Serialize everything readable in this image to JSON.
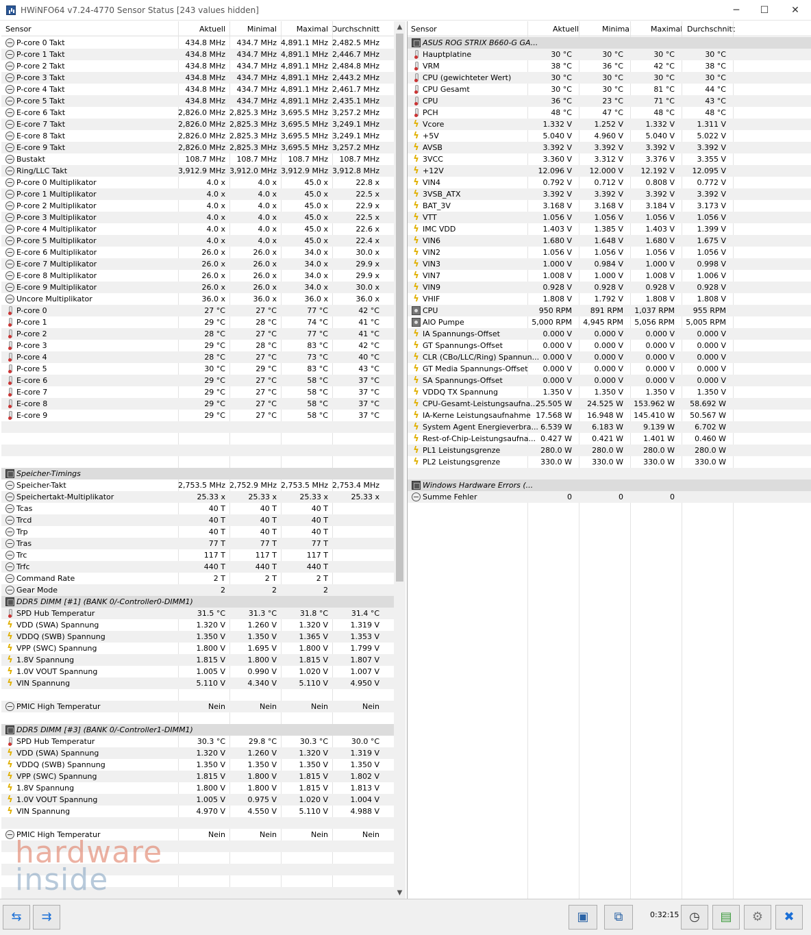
{
  "window": {
    "title": "HWiNFO64 v7.24-4770 Sensor Status [243 values hidden]",
    "minimize": "─",
    "maximize": "☐",
    "close": "✕"
  },
  "columns": {
    "sensor": "Sensor",
    "current": "Aktuell",
    "min": "Minimal",
    "max": "Maximal",
    "avg": "Durchschnitt"
  },
  "left_rows": [
    {
      "i": "clk",
      "n": "P-core 0 Takt",
      "a": "434.8 MHz",
      "mi": "434.7 MHz",
      "ma": "4,891.1 MHz",
      "av": "2,482.5 MHz"
    },
    {
      "i": "clk",
      "n": "P-core 1 Takt",
      "a": "434.8 MHz",
      "mi": "434.7 MHz",
      "ma": "4,891.1 MHz",
      "av": "2,446.7 MHz"
    },
    {
      "i": "clk",
      "n": "P-core 2 Takt",
      "a": "434.8 MHz",
      "mi": "434.7 MHz",
      "ma": "4,891.1 MHz",
      "av": "2,484.8 MHz"
    },
    {
      "i": "clk",
      "n": "P-core 3 Takt",
      "a": "434.8 MHz",
      "mi": "434.7 MHz",
      "ma": "4,891.1 MHz",
      "av": "2,443.2 MHz"
    },
    {
      "i": "clk",
      "n": "P-core 4 Takt",
      "a": "434.8 MHz",
      "mi": "434.7 MHz",
      "ma": "4,891.1 MHz",
      "av": "2,461.7 MHz"
    },
    {
      "i": "clk",
      "n": "P-core 5 Takt",
      "a": "434.8 MHz",
      "mi": "434.7 MHz",
      "ma": "4,891.1 MHz",
      "av": "2,435.1 MHz"
    },
    {
      "i": "clk",
      "n": "E-core 6 Takt",
      "a": "2,826.0 MHz",
      "mi": "2,825.3 MHz",
      "ma": "3,695.5 MHz",
      "av": "3,257.2 MHz"
    },
    {
      "i": "clk",
      "n": "E-core 7 Takt",
      "a": "2,826.0 MHz",
      "mi": "2,825.3 MHz",
      "ma": "3,695.5 MHz",
      "av": "3,249.1 MHz"
    },
    {
      "i": "clk",
      "n": "E-core 8 Takt",
      "a": "2,826.0 MHz",
      "mi": "2,825.3 MHz",
      "ma": "3,695.5 MHz",
      "av": "3,249.1 MHz"
    },
    {
      "i": "clk",
      "n": "E-core 9 Takt",
      "a": "2,826.0 MHz",
      "mi": "2,825.3 MHz",
      "ma": "3,695.5 MHz",
      "av": "3,257.2 MHz"
    },
    {
      "i": "clk",
      "n": "Bustakt",
      "a": "108.7 MHz",
      "mi": "108.7 MHz",
      "ma": "108.7 MHz",
      "av": "108.7 MHz"
    },
    {
      "i": "clk",
      "n": "Ring/LLC Takt",
      "a": "3,912.9 MHz",
      "mi": "3,912.0 MHz",
      "ma": "3,912.9 MHz",
      "av": "3,912.8 MHz"
    },
    {
      "i": "clk",
      "n": "P-core 0 Multiplikator",
      "a": "4.0 x",
      "mi": "4.0 x",
      "ma": "45.0 x",
      "av": "22.8 x"
    },
    {
      "i": "clk",
      "n": "P-core 1 Multiplikator",
      "a": "4.0 x",
      "mi": "4.0 x",
      "ma": "45.0 x",
      "av": "22.5 x"
    },
    {
      "i": "clk",
      "n": "P-core 2 Multiplikator",
      "a": "4.0 x",
      "mi": "4.0 x",
      "ma": "45.0 x",
      "av": "22.9 x"
    },
    {
      "i": "clk",
      "n": "P-core 3 Multiplikator",
      "a": "4.0 x",
      "mi": "4.0 x",
      "ma": "45.0 x",
      "av": "22.5 x"
    },
    {
      "i": "clk",
      "n": "P-core 4 Multiplikator",
      "a": "4.0 x",
      "mi": "4.0 x",
      "ma": "45.0 x",
      "av": "22.6 x"
    },
    {
      "i": "clk",
      "n": "P-core 5 Multiplikator",
      "a": "4.0 x",
      "mi": "4.0 x",
      "ma": "45.0 x",
      "av": "22.4 x"
    },
    {
      "i": "clk",
      "n": "E-core 6 Multiplikator",
      "a": "26.0 x",
      "mi": "26.0 x",
      "ma": "34.0 x",
      "av": "30.0 x"
    },
    {
      "i": "clk",
      "n": "E-core 7 Multiplikator",
      "a": "26.0 x",
      "mi": "26.0 x",
      "ma": "34.0 x",
      "av": "29.9 x"
    },
    {
      "i": "clk",
      "n": "E-core 8 Multiplikator",
      "a": "26.0 x",
      "mi": "26.0 x",
      "ma": "34.0 x",
      "av": "29.9 x"
    },
    {
      "i": "clk",
      "n": "E-core 9 Multiplikator",
      "a": "26.0 x",
      "mi": "26.0 x",
      "ma": "34.0 x",
      "av": "30.0 x"
    },
    {
      "i": "clk",
      "n": "Uncore Multiplikator",
      "a": "36.0 x",
      "mi": "36.0 x",
      "ma": "36.0 x",
      "av": "36.0 x"
    },
    {
      "i": "thm",
      "n": "P-core 0",
      "a": "27 °C",
      "mi": "27 °C",
      "ma": "77 °C",
      "av": "42 °C"
    },
    {
      "i": "thm",
      "n": "P-core 1",
      "a": "29 °C",
      "mi": "28 °C",
      "ma": "74 °C",
      "av": "41 °C"
    },
    {
      "i": "thm",
      "n": "P-core 2",
      "a": "28 °C",
      "mi": "27 °C",
      "ma": "77 °C",
      "av": "41 °C"
    },
    {
      "i": "thm",
      "n": "P-core 3",
      "a": "29 °C",
      "mi": "28 °C",
      "ma": "83 °C",
      "av": "42 °C"
    },
    {
      "i": "thm",
      "n": "P-core 4",
      "a": "28 °C",
      "mi": "27 °C",
      "ma": "73 °C",
      "av": "40 °C"
    },
    {
      "i": "thm",
      "n": "P-core 5",
      "a": "30 °C",
      "mi": "29 °C",
      "ma": "83 °C",
      "av": "43 °C"
    },
    {
      "i": "thm",
      "n": "E-core 6",
      "a": "29 °C",
      "mi": "27 °C",
      "ma": "58 °C",
      "av": "37 °C"
    },
    {
      "i": "thm",
      "n": "E-core 7",
      "a": "29 °C",
      "mi": "27 °C",
      "ma": "58 °C",
      "av": "37 °C"
    },
    {
      "i": "thm",
      "n": "E-core 8",
      "a": "29 °C",
      "mi": "27 °C",
      "ma": "58 °C",
      "av": "37 °C"
    },
    {
      "i": "thm",
      "n": "E-core 9",
      "a": "29 °C",
      "mi": "27 °C",
      "ma": "58 °C",
      "av": "37 °C"
    },
    {
      "i": "",
      "n": "",
      "a": "",
      "mi": "",
      "ma": "",
      "av": ""
    },
    {
      "i": "",
      "n": "",
      "a": "",
      "mi": "",
      "ma": "",
      "av": ""
    },
    {
      "i": "",
      "n": "",
      "a": "",
      "mi": "",
      "ma": "",
      "av": ""
    },
    {
      "i": "",
      "n": "",
      "a": "",
      "mi": "",
      "ma": "",
      "av": ""
    },
    {
      "i": "chip",
      "g": true,
      "n": "Speicher-Timings",
      "a": "",
      "mi": "",
      "ma": "",
      "av": ""
    },
    {
      "i": "clk",
      "n": "Speicher-Takt",
      "a": "2,753.5 MHz",
      "mi": "2,752.9 MHz",
      "ma": "2,753.5 MHz",
      "av": "2,753.4 MHz"
    },
    {
      "i": "clk",
      "n": "Speichertakt-Multiplikator",
      "a": "25.33 x",
      "mi": "25.33 x",
      "ma": "25.33 x",
      "av": "25.33 x"
    },
    {
      "i": "clk",
      "n": "Tcas",
      "a": "40 T",
      "mi": "40 T",
      "ma": "40 T",
      "av": ""
    },
    {
      "i": "clk",
      "n": "Trcd",
      "a": "40 T",
      "mi": "40 T",
      "ma": "40 T",
      "av": ""
    },
    {
      "i": "clk",
      "n": "Trp",
      "a": "40 T",
      "mi": "40 T",
      "ma": "40 T",
      "av": ""
    },
    {
      "i": "clk",
      "n": "Tras",
      "a": "77 T",
      "mi": "77 T",
      "ma": "77 T",
      "av": ""
    },
    {
      "i": "clk",
      "n": "Trc",
      "a": "117 T",
      "mi": "117 T",
      "ma": "117 T",
      "av": ""
    },
    {
      "i": "clk",
      "n": "Trfc",
      "a": "440 T",
      "mi": "440 T",
      "ma": "440 T",
      "av": ""
    },
    {
      "i": "clk",
      "n": "Command Rate",
      "a": "2 T",
      "mi": "2 T",
      "ma": "2 T",
      "av": ""
    },
    {
      "i": "clk",
      "n": "Gear Mode",
      "a": "2",
      "mi": "2",
      "ma": "2",
      "av": ""
    },
    {
      "i": "chip",
      "g": true,
      "n": "DDR5 DIMM [#1] (BANK 0/-Controller0-DIMM1)",
      "a": "",
      "mi": "",
      "ma": "",
      "av": ""
    },
    {
      "i": "thm",
      "n": "SPD Hub Temperatur",
      "a": "31.5 °C",
      "mi": "31.3 °C",
      "ma": "31.8 °C",
      "av": "31.4 °C"
    },
    {
      "i": "volt",
      "n": "VDD (SWA) Spannung",
      "a": "1.320 V",
      "mi": "1.260 V",
      "ma": "1.320 V",
      "av": "1.319 V"
    },
    {
      "i": "volt",
      "n": "VDDQ (SWB) Spannung",
      "a": "1.350 V",
      "mi": "1.350 V",
      "ma": "1.365 V",
      "av": "1.353 V"
    },
    {
      "i": "volt",
      "n": "VPP (SWC) Spannung",
      "a": "1.800 V",
      "mi": "1.695 V",
      "ma": "1.800 V",
      "av": "1.799 V"
    },
    {
      "i": "volt",
      "n": "1.8V Spannung",
      "a": "1.815 V",
      "mi": "1.800 V",
      "ma": "1.815 V",
      "av": "1.807 V"
    },
    {
      "i": "volt",
      "n": "1.0V VOUT Spannung",
      "a": "1.005 V",
      "mi": "0.990 V",
      "ma": "1.020 V",
      "av": "1.007 V"
    },
    {
      "i": "volt",
      "n": "VIN Spannung",
      "a": "5.110 V",
      "mi": "4.340 V",
      "ma": "5.110 V",
      "av": "4.950 V"
    },
    {
      "i": "",
      "n": "",
      "a": "",
      "mi": "",
      "ma": "",
      "av": ""
    },
    {
      "i": "clk",
      "n": "PMIC High Temperatur",
      "a": "Nein",
      "mi": "Nein",
      "ma": "Nein",
      "av": "Nein"
    },
    {
      "i": "",
      "n": "",
      "a": "",
      "mi": "",
      "ma": "",
      "av": ""
    },
    {
      "i": "chip",
      "g": true,
      "n": "DDR5 DIMM [#3] (BANK 0/-Controller1-DIMM1)",
      "a": "",
      "mi": "",
      "ma": "",
      "av": ""
    },
    {
      "i": "thm",
      "n": "SPD Hub Temperatur",
      "a": "30.3 °C",
      "mi": "29.8 °C",
      "ma": "30.3 °C",
      "av": "30.0 °C"
    },
    {
      "i": "volt",
      "n": "VDD (SWA) Spannung",
      "a": "1.320 V",
      "mi": "1.260 V",
      "ma": "1.320 V",
      "av": "1.319 V"
    },
    {
      "i": "volt",
      "n": "VDDQ (SWB) Spannung",
      "a": "1.350 V",
      "mi": "1.350 V",
      "ma": "1.350 V",
      "av": "1.350 V"
    },
    {
      "i": "volt",
      "n": "VPP (SWC) Spannung",
      "a": "1.815 V",
      "mi": "1.800 V",
      "ma": "1.815 V",
      "av": "1.802 V"
    },
    {
      "i": "volt",
      "n": "1.8V Spannung",
      "a": "1.800 V",
      "mi": "1.800 V",
      "ma": "1.815 V",
      "av": "1.813 V"
    },
    {
      "i": "volt",
      "n": "1.0V VOUT Spannung",
      "a": "1.005 V",
      "mi": "0.975 V",
      "ma": "1.020 V",
      "av": "1.004 V"
    },
    {
      "i": "volt",
      "n": "VIN Spannung",
      "a": "4.970 V",
      "mi": "4.550 V",
      "ma": "5.110 V",
      "av": "4.988 V"
    },
    {
      "i": "",
      "n": "",
      "a": "",
      "mi": "",
      "ma": "",
      "av": ""
    },
    {
      "i": "clk",
      "n": "PMIC High Temperatur",
      "a": "Nein",
      "mi": "Nein",
      "ma": "Nein",
      "av": "Nein"
    },
    {
      "i": "",
      "n": "",
      "a": "",
      "mi": "",
      "ma": "",
      "av": ""
    },
    {
      "i": "",
      "n": "",
      "a": "",
      "mi": "",
      "ma": "",
      "av": ""
    },
    {
      "i": "",
      "n": "",
      "a": "",
      "mi": "",
      "ma": "",
      "av": ""
    },
    {
      "i": "",
      "n": "",
      "a": "",
      "mi": "",
      "ma": "",
      "av": ""
    },
    {
      "i": "",
      "n": "",
      "a": "",
      "mi": "",
      "ma": "",
      "av": ""
    }
  ],
  "right_rows": [
    {
      "i": "chip",
      "g": true,
      "n": "ASUS ROG STRIX B660-G GA...",
      "a": "",
      "mi": "",
      "ma": "",
      "av": ""
    },
    {
      "i": "thm",
      "n": "Hauptplatine",
      "a": "30 °C",
      "mi": "30 °C",
      "ma": "30 °C",
      "av": "30 °C"
    },
    {
      "i": "thm",
      "n": "VRM",
      "a": "38 °C",
      "mi": "36 °C",
      "ma": "42 °C",
      "av": "38 °C"
    },
    {
      "i": "thm",
      "n": "CPU (gewichteter Wert)",
      "a": "30 °C",
      "mi": "30 °C",
      "ma": "30 °C",
      "av": "30 °C"
    },
    {
      "i": "thm",
      "n": "CPU Gesamt",
      "a": "30 °C",
      "mi": "30 °C",
      "ma": "81 °C",
      "av": "44 °C"
    },
    {
      "i": "thm",
      "n": "CPU",
      "a": "36 °C",
      "mi": "23 °C",
      "ma": "71 °C",
      "av": "43 °C"
    },
    {
      "i": "thm",
      "n": "PCH",
      "a": "48 °C",
      "mi": "47 °C",
      "ma": "48 °C",
      "av": "48 °C"
    },
    {
      "i": "volt",
      "n": "Vcore",
      "a": "1.332 V",
      "mi": "1.252 V",
      "ma": "1.332 V",
      "av": "1.311 V"
    },
    {
      "i": "volt",
      "n": "+5V",
      "a": "5.040 V",
      "mi": "4.960 V",
      "ma": "5.040 V",
      "av": "5.022 V"
    },
    {
      "i": "volt",
      "n": "AVSB",
      "a": "3.392 V",
      "mi": "3.392 V",
      "ma": "3.392 V",
      "av": "3.392 V"
    },
    {
      "i": "volt",
      "n": "3VCC",
      "a": "3.360 V",
      "mi": "3.312 V",
      "ma": "3.376 V",
      "av": "3.355 V"
    },
    {
      "i": "volt",
      "n": "+12V",
      "a": "12.096 V",
      "mi": "12.000 V",
      "ma": "12.192 V",
      "av": "12.095 V"
    },
    {
      "i": "volt",
      "n": "VIN4",
      "a": "0.792 V",
      "mi": "0.712 V",
      "ma": "0.808 V",
      "av": "0.772 V"
    },
    {
      "i": "volt",
      "n": "3VSB_ATX",
      "a": "3.392 V",
      "mi": "3.392 V",
      "ma": "3.392 V",
      "av": "3.392 V"
    },
    {
      "i": "volt",
      "n": "BAT_3V",
      "a": "3.168 V",
      "mi": "3.168 V",
      "ma": "3.184 V",
      "av": "3.173 V"
    },
    {
      "i": "volt",
      "n": "VTT",
      "a": "1.056 V",
      "mi": "1.056 V",
      "ma": "1.056 V",
      "av": "1.056 V"
    },
    {
      "i": "volt",
      "n": "IMC VDD",
      "a": "1.403 V",
      "mi": "1.385 V",
      "ma": "1.403 V",
      "av": "1.399 V"
    },
    {
      "i": "volt",
      "n": "VIN6",
      "a": "1.680 V",
      "mi": "1.648 V",
      "ma": "1.680 V",
      "av": "1.675 V"
    },
    {
      "i": "volt",
      "n": "VIN2",
      "a": "1.056 V",
      "mi": "1.056 V",
      "ma": "1.056 V",
      "av": "1.056 V"
    },
    {
      "i": "volt",
      "n": "VIN3",
      "a": "1.000 V",
      "mi": "0.984 V",
      "ma": "1.000 V",
      "av": "0.998 V"
    },
    {
      "i": "volt",
      "n": "VIN7",
      "a": "1.008 V",
      "mi": "1.000 V",
      "ma": "1.008 V",
      "av": "1.006 V"
    },
    {
      "i": "volt",
      "n": "VIN9",
      "a": "0.928 V",
      "mi": "0.928 V",
      "ma": "0.928 V",
      "av": "0.928 V"
    },
    {
      "i": "volt",
      "n": "VHIF",
      "a": "1.808 V",
      "mi": "1.792 V",
      "ma": "1.808 V",
      "av": "1.808 V"
    },
    {
      "i": "fan",
      "n": "CPU",
      "a": "950 RPM",
      "mi": "891 RPM",
      "ma": "1,037 RPM",
      "av": "955 RPM"
    },
    {
      "i": "fan",
      "n": "AIO Pumpe",
      "a": "5,000 RPM",
      "mi": "4,945 RPM",
      "ma": "5,056 RPM",
      "av": "5,005 RPM"
    },
    {
      "i": "volt",
      "n": "IA Spannungs-Offset",
      "a": "0.000 V",
      "mi": "0.000 V",
      "ma": "0.000 V",
      "av": "0.000 V"
    },
    {
      "i": "volt",
      "n": "GT Spannungs-Offset",
      "a": "0.000 V",
      "mi": "0.000 V",
      "ma": "0.000 V",
      "av": "0.000 V"
    },
    {
      "i": "volt",
      "n": "CLR (CBo/LLC/Ring) Spannun...",
      "a": "0.000 V",
      "mi": "0.000 V",
      "ma": "0.000 V",
      "av": "0.000 V"
    },
    {
      "i": "volt",
      "n": "GT Media Spannungs-Offset",
      "a": "0.000 V",
      "mi": "0.000 V",
      "ma": "0.000 V",
      "av": "0.000 V"
    },
    {
      "i": "volt",
      "n": "SA Spannungs-Offset",
      "a": "0.000 V",
      "mi": "0.000 V",
      "ma": "0.000 V",
      "av": "0.000 V"
    },
    {
      "i": "volt",
      "n": "VDDQ TX Spannung",
      "a": "1.350 V",
      "mi": "1.350 V",
      "ma": "1.350 V",
      "av": "1.350 V"
    },
    {
      "i": "volt",
      "n": "CPU-Gesamt-Leistungsaufna...",
      "a": "25.505 W",
      "mi": "24.525 W",
      "ma": "153.962 W",
      "av": "58.692 W"
    },
    {
      "i": "volt",
      "n": "IA-Kerne Leistungsaufnahme",
      "a": "17.568 W",
      "mi": "16.948 W",
      "ma": "145.410 W",
      "av": "50.567 W"
    },
    {
      "i": "volt",
      "n": "System Agent Energieverbra...",
      "a": "6.539 W",
      "mi": "6.183 W",
      "ma": "9.139 W",
      "av": "6.702 W"
    },
    {
      "i": "volt",
      "n": "Rest-of-Chip-Leistungsaufna...",
      "a": "0.427 W",
      "mi": "0.421 W",
      "ma": "1.401 W",
      "av": "0.460 W"
    },
    {
      "i": "volt",
      "n": "PL1 Leistungsgrenze",
      "a": "280.0 W",
      "mi": "280.0 W",
      "ma": "280.0 W",
      "av": "280.0 W"
    },
    {
      "i": "volt",
      "n": "PL2 Leistungsgrenze",
      "a": "330.0 W",
      "mi": "330.0 W",
      "ma": "330.0 W",
      "av": "330.0 W"
    },
    {
      "i": "",
      "n": "",
      "a": "",
      "mi": "",
      "ma": "",
      "av": ""
    },
    {
      "i": "chip",
      "g": true,
      "n": "Windows Hardware Errors (...",
      "a": "",
      "mi": "",
      "ma": "",
      "av": ""
    },
    {
      "i": "clk",
      "n": "Summe Fehler",
      "a": "0",
      "mi": "0",
      "ma": "0",
      "av": ""
    }
  ],
  "watermark": {
    "line1": "hardware",
    "line2": "inside"
  },
  "status": {
    "timer": "0:32:15"
  },
  "icons": {
    "nav_left": "arrows-left-right-icon",
    "nav_right": "arrows-converge-icon",
    "monitor": "monitor-icon",
    "network": "network-icon",
    "clock": "clock-icon",
    "report": "report-add-icon",
    "settings": "gear-icon",
    "close": "close-x-icon"
  }
}
